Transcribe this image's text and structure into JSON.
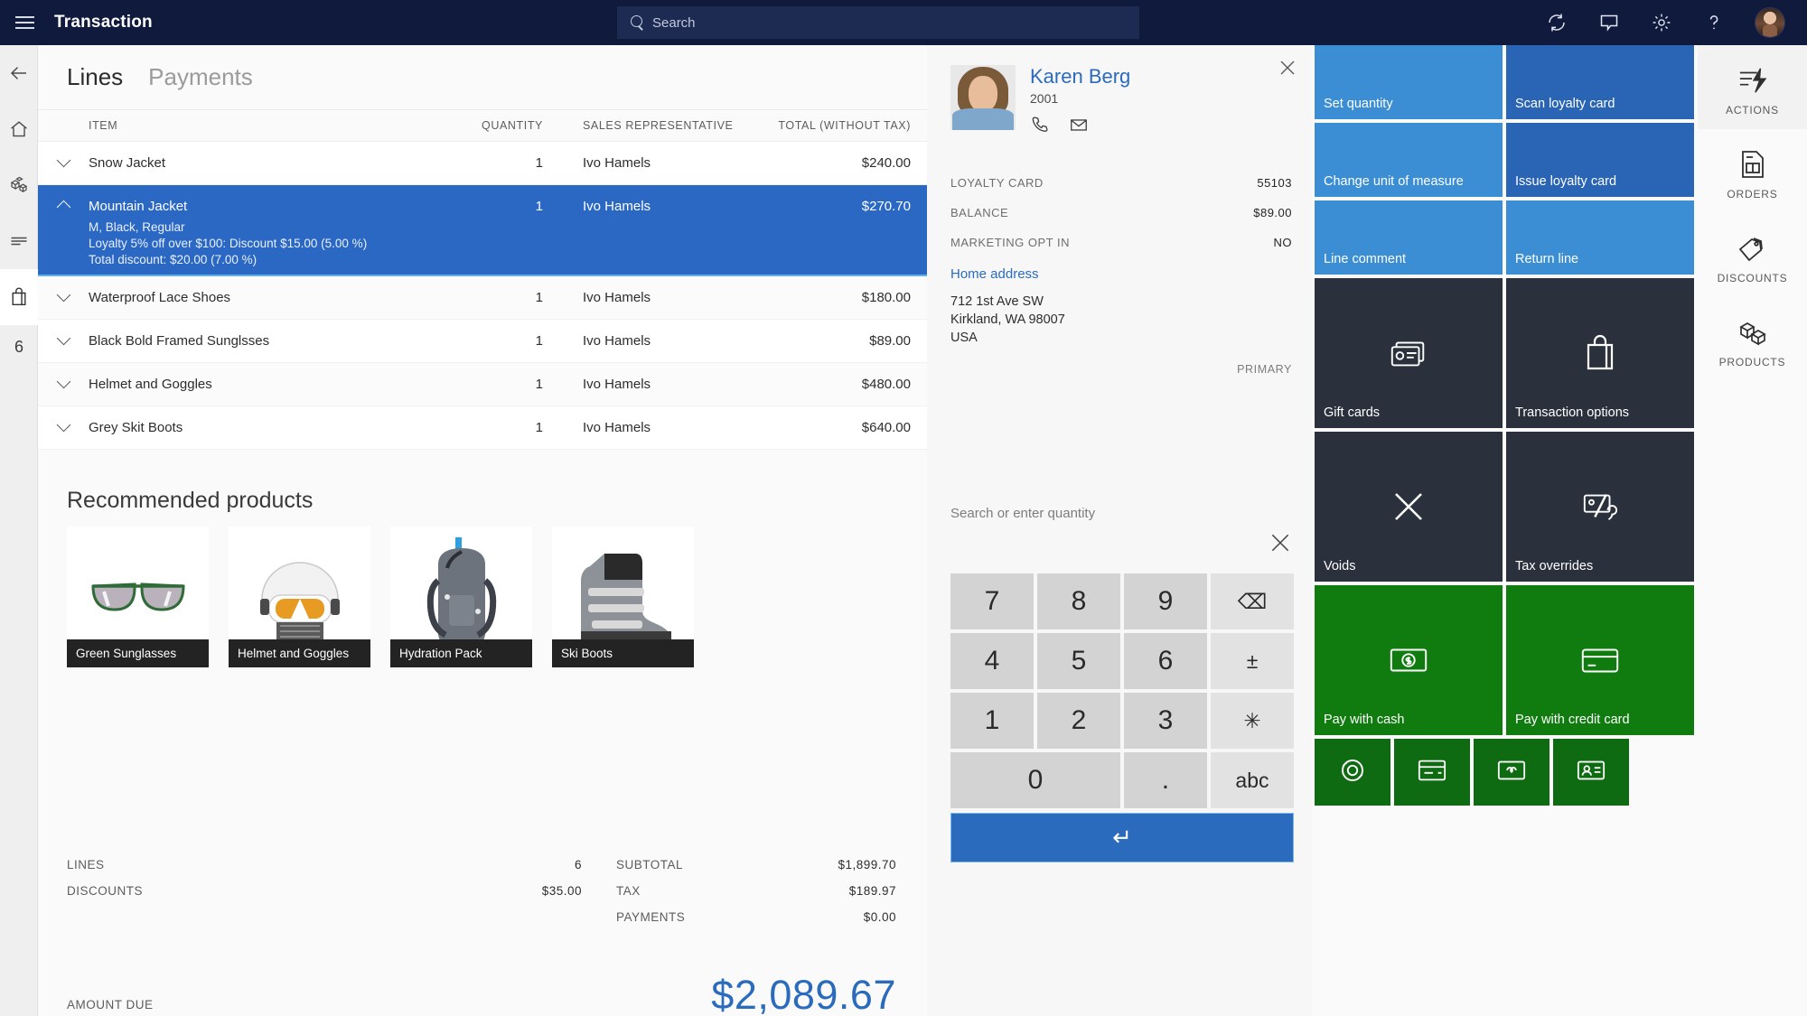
{
  "topbar": {
    "title": "Transaction",
    "menu_icon": "hamburger-icon",
    "search_placeholder": "Search",
    "icons": [
      "sync-icon",
      "chat-icon",
      "gear-icon",
      "help-icon",
      "user-avatar"
    ]
  },
  "left_rail": {
    "items": [
      {
        "name": "back-icon",
        "label": ""
      },
      {
        "name": "home-icon",
        "label": ""
      },
      {
        "name": "products-icon",
        "label": ""
      },
      {
        "name": "lines-icon",
        "label": ""
      },
      {
        "name": "cart-icon",
        "label": ""
      }
    ],
    "count": "6"
  },
  "main": {
    "tabs": [
      {
        "label": "Lines",
        "active": true
      },
      {
        "label": "Payments",
        "active": false
      }
    ],
    "columns": {
      "item": "ITEM",
      "quantity": "QUANTITY",
      "sales_rep": "SALES REPRESENTATIVE",
      "total": "TOTAL (WITHOUT TAX)"
    },
    "rows": [
      {
        "item": "Snow Jacket",
        "qty": "1",
        "rep": "Ivo Hamels",
        "total": "$240.00",
        "selected": false
      },
      {
        "item": "Mountain Jacket",
        "qty": "1",
        "rep": "Ivo Hamels",
        "total": "$270.70",
        "selected": true,
        "details": [
          "M, Black, Regular",
          "Loyalty 5% off over $100: Discount $15.00 (5.00 %)",
          "Total discount: $20.00 (7.00 %)"
        ]
      },
      {
        "item": "Waterproof Lace Shoes",
        "qty": "1",
        "rep": "Ivo Hamels",
        "total": "$180.00",
        "selected": false
      },
      {
        "item": "Black Bold Framed Sunglsses",
        "qty": "1",
        "rep": "Ivo Hamels",
        "total": "$89.00",
        "selected": false
      },
      {
        "item": "Helmet and Goggles",
        "qty": "1",
        "rep": "Ivo Hamels",
        "total": "$480.00",
        "selected": false
      },
      {
        "item": "Grey Skit Boots",
        "qty": "1",
        "rep": "Ivo Hamels",
        "total": "$640.00",
        "selected": false
      }
    ],
    "recommended_title": "Recommended products",
    "recommended": [
      {
        "label": "Green Sunglasses",
        "image": "sunglasses-image"
      },
      {
        "label": "Helmet and Goggles",
        "image": "helmet-goggles-image"
      },
      {
        "label": "Hydration Pack",
        "image": "backpack-image"
      },
      {
        "label": "Ski Boots",
        "image": "ski-boot-image"
      }
    ],
    "totals": {
      "lines_label": "LINES",
      "lines_value": "6",
      "discounts_label": "DISCOUNTS",
      "discounts_value": "$35.00",
      "subtotal_label": "SUBTOTAL",
      "subtotal_value": "$1,899.70",
      "tax_label": "TAX",
      "tax_value": "$189.97",
      "payments_label": "PAYMENTS",
      "payments_value": "$0.00",
      "amount_due_label": "AMOUNT DUE",
      "amount_due_value": "$2,089.67"
    }
  },
  "customer": {
    "name": "Karen Berg",
    "id": "2001",
    "phone_icon": "phone-icon",
    "email_icon": "envelope-icon",
    "close_icon": "close-icon",
    "loyalty_card_label": "LOYALTY CARD",
    "loyalty_card_value": "55103",
    "balance_label": "BALANCE",
    "balance_value": "$89.00",
    "marketing_label": "MARKETING OPT IN",
    "marketing_value": "NO",
    "address_link": "Home address",
    "address_line1": "712 1st Ave SW",
    "address_line2": "Kirkland, WA 98007",
    "address_line3": "USA",
    "address_tag": "PRIMARY"
  },
  "keypad": {
    "prompt": "Search or enter quantity",
    "clear_icon": "close-icon",
    "keys": [
      [
        "7",
        "8",
        "9",
        "⌫"
      ],
      [
        "4",
        "5",
        "6",
        "±"
      ],
      [
        "1",
        "2",
        "3",
        "✳"
      ],
      [
        "0",
        ".",
        "abc"
      ]
    ],
    "enter_label": "↵"
  },
  "tiles": {
    "rows": [
      [
        {
          "label": "Set quantity",
          "color": "#3b8ed4",
          "icon": ""
        },
        {
          "label": "Scan loyalty card",
          "color": "#2a64b4",
          "icon": ""
        }
      ],
      [
        {
          "label": "Change unit of measure",
          "color": "#3b8ed4",
          "icon": ""
        },
        {
          "label": "Issue loyalty card",
          "color": "#2a64b4",
          "icon": ""
        }
      ],
      [
        {
          "label": "Line comment",
          "color": "#3b8ed4",
          "icon": ""
        },
        {
          "label": "Return line",
          "color": "#3b8ed4",
          "icon": ""
        }
      ],
      [
        {
          "label": "Gift cards",
          "color": "#2b303d",
          "icon": "gift-card-icon"
        },
        {
          "label": "Transaction options",
          "color": "#2b303d",
          "icon": "shopping-bag-icon"
        }
      ],
      [
        {
          "label": "Voids",
          "color": "#2b303d",
          "icon": "close-x-icon"
        },
        {
          "label": "Tax overrides",
          "color": "#2b303d",
          "icon": "tax-percent-icon"
        }
      ],
      [
        {
          "label": "Pay with cash",
          "color": "#107c10",
          "icon": "cash-icon"
        },
        {
          "label": "Pay with credit card",
          "color": "#107c10",
          "icon": "credit-card-icon"
        }
      ]
    ],
    "mini": [
      {
        "icon": "coins-icon"
      },
      {
        "icon": "check-icon"
      },
      {
        "icon": "gift-card-small-icon"
      },
      {
        "icon": "id-card-icon"
      }
    ]
  },
  "right_rail": {
    "items": [
      {
        "label": "ACTIONS",
        "icon": "actions-lightning-icon",
        "active": true
      },
      {
        "label": "ORDERS",
        "icon": "orders-document-icon",
        "active": false
      },
      {
        "label": "DISCOUNTS",
        "icon": "discount-tag-icon",
        "active": false
      },
      {
        "label": "PRODUCTS",
        "icon": "products-cube-icon",
        "active": false
      }
    ]
  },
  "colors": {
    "topbar": "#101a3d",
    "accent_blue": "#2b6bbd",
    "selection_blue": "#2b68c4",
    "tile_blue": "#3b8ed4",
    "tile_dark_blue": "#2a64b4",
    "tile_dark": "#2b303d",
    "tile_green": "#107c10"
  }
}
